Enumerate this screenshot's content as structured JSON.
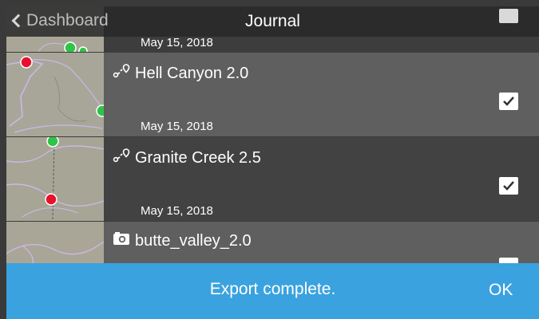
{
  "header": {
    "back_label": "Dashboard",
    "title": "Journal"
  },
  "top_row": {
    "date": "May 15, 2018",
    "checked": false
  },
  "rows": [
    {
      "name": "Hell Canyon 2.0",
      "date": "May 15, 2018",
      "type": "route",
      "icon": "route-icon",
      "checked": true
    },
    {
      "name": "Granite Creek 2.5",
      "date": "May 15, 2018",
      "type": "route",
      "icon": "route-icon",
      "checked": true
    },
    {
      "name": "butte_valley_2.0",
      "type": "photo",
      "icon": "camera-icon",
      "checked": false
    }
  ],
  "toast": {
    "message": "Export complete.",
    "action": "OK"
  },
  "colors": {
    "toast_bg": "#3aa2df",
    "row_light": "#5f5f5f",
    "row_dark": "#424242",
    "marker_start": "#e8112d",
    "marker_end": "#2ec448"
  }
}
